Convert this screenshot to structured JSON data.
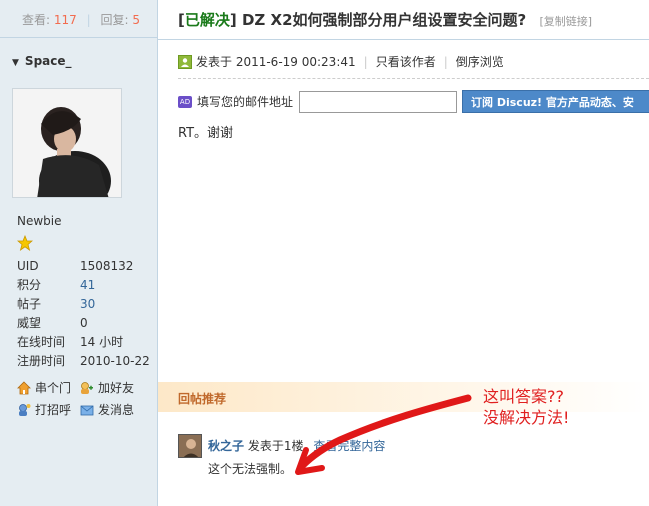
{
  "stats": {
    "views_label": "查看:",
    "views": "117",
    "sep": "|",
    "replies_label": "回复:",
    "replies": "5"
  },
  "user": {
    "name": "Space_",
    "group": "Newbie",
    "profile": [
      {
        "k": "UID",
        "v": "1508132"
      },
      {
        "k": "积分",
        "v": "41"
      },
      {
        "k": "帖子",
        "v": "30"
      },
      {
        "k": "威望",
        "v": "0"
      },
      {
        "k": "在线时间",
        "v": "14 小时"
      },
      {
        "k": "注册时间",
        "v": "2010-10-22"
      }
    ],
    "actions": [
      {
        "label": "串个门",
        "icon": "home-icon"
      },
      {
        "label": "加好友",
        "icon": "add-friend-icon"
      },
      {
        "label": "打招呼",
        "icon": "greet-icon"
      },
      {
        "label": "发消息",
        "icon": "message-icon"
      }
    ]
  },
  "thread": {
    "tag_open": "[",
    "tag": "已解决",
    "tag_close": "]",
    "title": "DZ X2如何强制部分用户组设置安全问题?",
    "copy_link": "[复制链接]"
  },
  "post": {
    "posted": "发表于 2011-6-19 00:23:41",
    "author_only": "只看该作者",
    "reverse": "倒序浏览",
    "subscribe_label": "填写您的邮件地址",
    "subscribe_button": "订阅 Discuz! 官方产品动态、安",
    "content": "RT。谢谢"
  },
  "recommend": {
    "label": "回帖推荐"
  },
  "reply": {
    "author": "秋之子",
    "posted": "发表于1楼",
    "view_all": "查看完整内容",
    "body": "这个无法强制。"
  },
  "annotation": {
    "line1": "这叫答案??",
    "line2": "没解决方法!"
  },
  "colors": {
    "sidebar": "#e5edf2",
    "accent_link": "#336699",
    "solved": "#1a7a1a",
    "annotation": "#e02020",
    "button": "#4d89c9"
  }
}
